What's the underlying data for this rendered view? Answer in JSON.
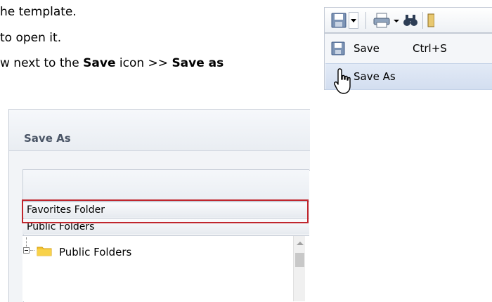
{
  "instructions": {
    "line1": "he template.",
    "line2": " to open it.",
    "line3_prefix": "w next to the ",
    "line3_bold1": "Save",
    "line3_mid": " icon >> ",
    "line3_bold2": "Save as"
  },
  "dialog": {
    "title": "Save As",
    "favorites_label": "Favorites Folder",
    "public_label": "Public Folders",
    "tree_root_label": "Public Folders"
  },
  "toolbar": {
    "icons": [
      "save-icon",
      "dropdown-arrow-icon",
      "print-icon",
      "binoculars-icon"
    ]
  },
  "menu": {
    "save_label": "Save",
    "save_shortcut": "Ctrl+S",
    "save_as_label": "Save As"
  },
  "colors": {
    "highlight": "#c0262d",
    "menu_hover": "#d3def0",
    "folder_yellow": "#f4c430"
  }
}
